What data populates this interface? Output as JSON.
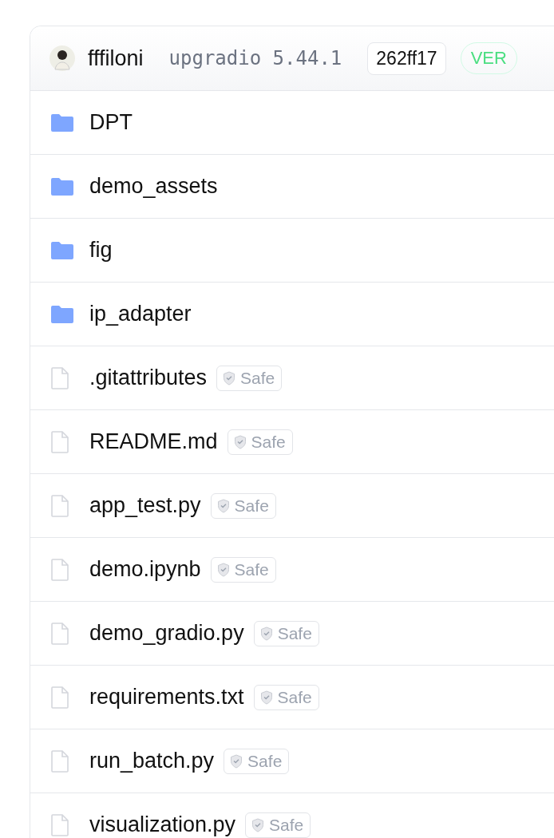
{
  "header": {
    "author": "fffiloni",
    "commit_message": "upgradio 5.44.1",
    "commit_hash": "262ff17",
    "status_badge": "VER"
  },
  "files": [
    {
      "kind": "folder",
      "name": "DPT"
    },
    {
      "kind": "folder",
      "name": "demo_assets"
    },
    {
      "kind": "folder",
      "name": "fig"
    },
    {
      "kind": "folder",
      "name": "ip_adapter"
    },
    {
      "kind": "file",
      "name": ".gitattributes",
      "badge": "Safe"
    },
    {
      "kind": "file",
      "name": "README.md",
      "badge": "Safe"
    },
    {
      "kind": "file",
      "name": "app_test.py",
      "badge": "Safe"
    },
    {
      "kind": "file",
      "name": "demo.ipynb",
      "badge": "Safe"
    },
    {
      "kind": "file",
      "name": "demo_gradio.py",
      "badge": "Safe"
    },
    {
      "kind": "file",
      "name": "requirements.txt",
      "badge": "Safe"
    },
    {
      "kind": "file",
      "name": "run_batch.py",
      "badge": "Safe"
    },
    {
      "kind": "file",
      "name": "visualization.py",
      "badge": "Safe"
    }
  ]
}
